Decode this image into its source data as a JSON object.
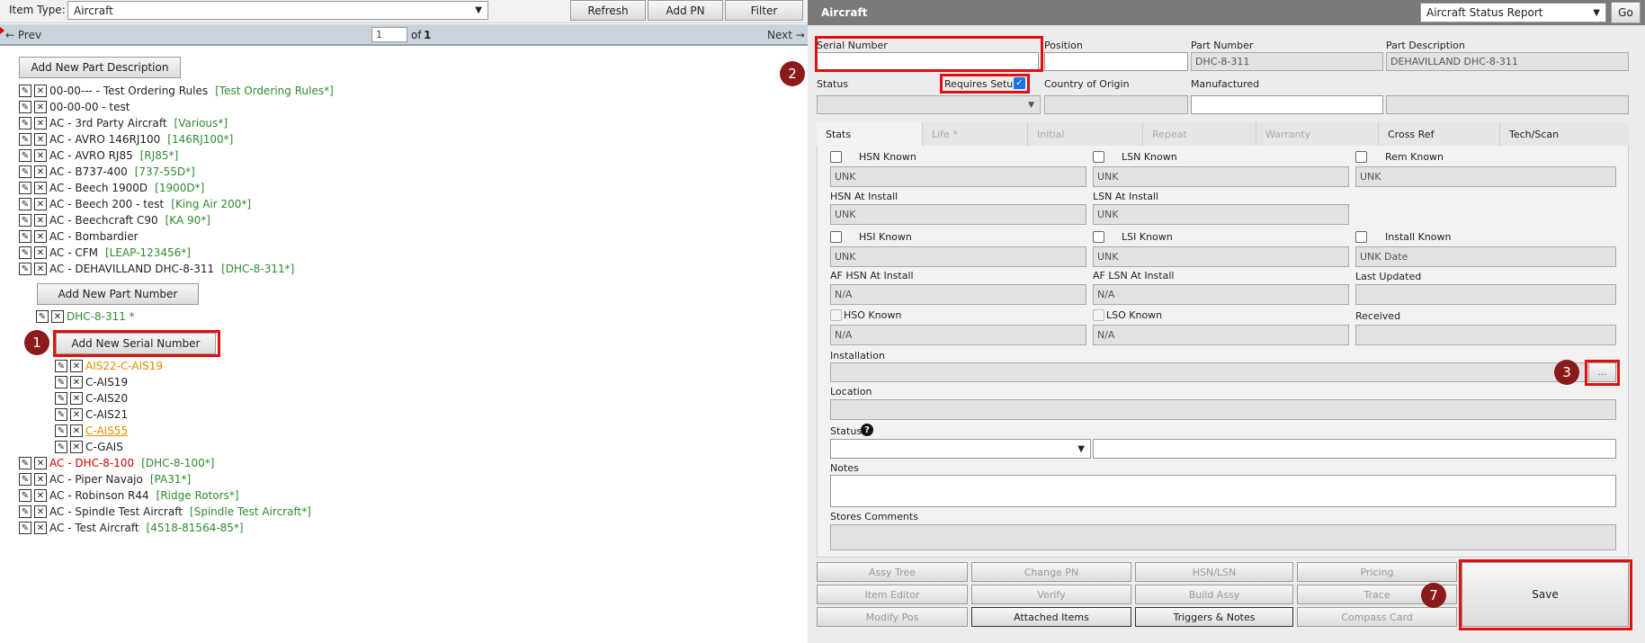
{
  "toolbar": {
    "item_type_label": "Item Type:",
    "item_type_value": "Aircraft",
    "refresh": "Refresh",
    "add_pn": "Add PN",
    "filter": "Filter"
  },
  "pager": {
    "prev": "← Prev",
    "page": "1",
    "of_label": "of",
    "total": "1",
    "next": "Next →"
  },
  "tree": {
    "add_part_description": "Add New Part Description",
    "items": [
      {
        "name": "00-00--- - Test Ordering Rules",
        "tag": "[Test Ordering Rules*]"
      },
      {
        "name": "00-00-00 - test",
        "tag": ""
      },
      {
        "name": "AC - 3rd Party Aircraft",
        "tag": "[Various*]"
      },
      {
        "name": "AC - AVRO 146RJ100",
        "tag": "[146RJ100*]"
      },
      {
        "name": "AC - AVRO RJ85",
        "tag": "[RJ85*]"
      },
      {
        "name": "AC - B737-400",
        "tag": "[737-55D*]"
      },
      {
        "name": "AC - Beech 1900D",
        "tag": "[1900D*]"
      },
      {
        "name": "AC - Beech 200 - test",
        "tag": "[King Air 200*]"
      },
      {
        "name": "AC - Beechcraft C90",
        "tag": "[KA 90*]"
      },
      {
        "name": "AC - Bombardier",
        "tag": ""
      },
      {
        "name": "AC - CFM",
        "tag": "[LEAP-123456*]"
      },
      {
        "name": "AC - DEHAVILLAND DHC-8-311",
        "tag": "[DHC-8-311*]"
      }
    ],
    "add_part_number": "Add New Part Number",
    "part_number": "DHC-8-311 *",
    "add_serial_number": "Add New Serial Number",
    "serials": [
      "AIS22-C-AIS19",
      "C-AIS19",
      "C-AIS20",
      "C-AIS21",
      "C-AIS55",
      "C-GAIS"
    ],
    "items_after": [
      {
        "name": "AC - DHC-8-100",
        "tag": "[DHC-8-100*]"
      },
      {
        "name": "AC - Piper Navajo",
        "tag": "[PA31*]"
      },
      {
        "name": "AC - Robinson R44",
        "tag": "[Ridge Rotors*]"
      },
      {
        "name": "AC - Spindle Test Aircraft",
        "tag": "[Spindle Test Aircraft*]"
      },
      {
        "name": "AC - Test Aircraft",
        "tag": "[4518-81564-85*]"
      }
    ]
  },
  "form": {
    "title": "Aircraft",
    "report_select": "Aircraft Status Report",
    "go": "Go",
    "serial_number_label": "Serial Number",
    "position_label": "Position",
    "part_number_label": "Part Number",
    "part_number_value": "DHC-8-311",
    "part_description_label": "Part Description",
    "part_description_value": "DEHAVILLAND DHC-8-311",
    "status_label": "Status",
    "requires_setup_label": "Requires Setup",
    "country_label": "Country of Origin",
    "manufactured_label": "Manufactured",
    "tabs": [
      "Stats",
      "Life *",
      "Initial",
      "Repeat",
      "Warranty",
      "Cross Ref",
      "Tech/Scan"
    ],
    "hsn_known": "HSN Known",
    "lsn_known": "LSN Known",
    "rem_known": "Rem Known",
    "unk": "UNK",
    "hsn_at_install": "HSN At Install",
    "lsn_at_install": "LSN At Install",
    "hsi_known": "HSI Known",
    "lsi_known": "LSI Known",
    "install_known": "Install Known",
    "unk_date": "UNK Date",
    "af_hsn_at_install": "AF HSN At Install",
    "af_lsn_at_install": "AF LSN At Install",
    "last_updated": "Last Updated",
    "na": "N/A",
    "hso_known": "HSO Known",
    "lso_known": "LSO Known",
    "received": "Received",
    "installation": "Installation",
    "ellipsis": "...",
    "location": "Location",
    "status2": "Status",
    "notes": "Notes",
    "stores_comments": "Stores Comments"
  },
  "actions": {
    "assy_tree": "Assy Tree",
    "change_pn": "Change PN",
    "hsn_lsn": "HSN/LSN",
    "pricing": "Pricing",
    "item_editor": "Item Editor",
    "verify": "Verify",
    "build_assy": "Build Assy",
    "trace": "Trace",
    "modify_pos": "Modify Pos",
    "attached_items": "Attached Items",
    "triggers_notes": "Triggers & Notes",
    "compass_card": "Compass Card",
    "save": "Save"
  },
  "badges": [
    "1",
    "2",
    "3",
    "7"
  ],
  "colors": {
    "header_bg": "#7a7a7a",
    "pager_bg": "#c9d3dc",
    "highlight": "#e01010",
    "badge": "#8b1a1a",
    "green_tag": "#2e8b2e",
    "orange": "#e88a00",
    "red": "#d40000"
  }
}
